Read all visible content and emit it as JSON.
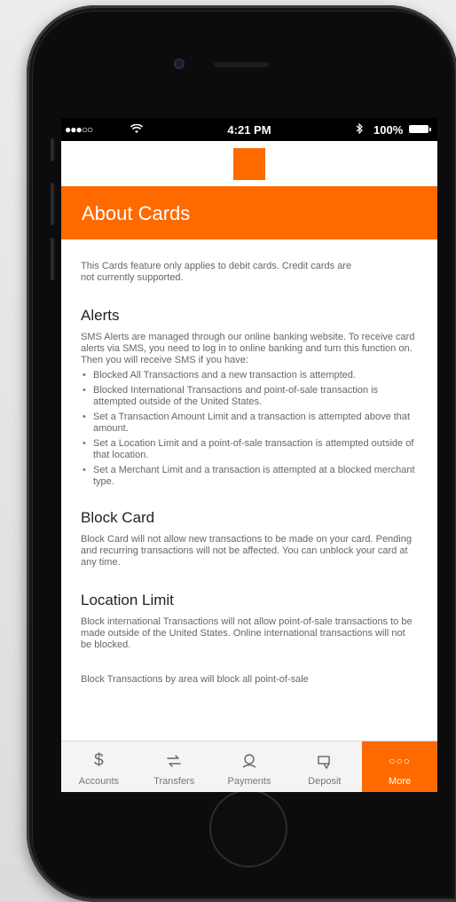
{
  "status_bar": {
    "signal": "●●●○○",
    "time": "4:21 PM",
    "battery": "100%"
  },
  "colors": {
    "brand": "#ff6a00"
  },
  "header": {
    "title": "About Cards"
  },
  "content": {
    "intro": "This Cards feature only applies to debit cards. Credit cards are not currently supported.",
    "alerts": {
      "heading": "Alerts",
      "text": "SMS Alerts are managed through our online banking website. To receive card alerts via SMS, you need to log in to online banking and turn this function on. Then you will receive SMS if you have:",
      "bullets": [
        "Blocked All Transactions and a new transaction is attempted.",
        "Blocked International Transactions and point-of-sale transaction is attempted outside of the United States.",
        "Set a Transaction Amount Limit and a transaction is attempted above that amount.",
        "Set a Location Limit and a point-of-sale transaction is attempted outside of that location.",
        "Set a Merchant Limit and a transaction is attempted at a blocked merchant type."
      ]
    },
    "block_card": {
      "heading": "Block Card",
      "text": "Block Card will not allow new transactions to be made on your card. Pending and recurring transactions will not be affected. You can unblock your card at any time."
    },
    "location_limit": {
      "heading": "Location Limit",
      "text": "Block international Transactions will not allow point-of-sale transactions to be made outside of the United States. Online international transactions will not be blocked.",
      "more": "Block Transactions by area will block all point-of-sale"
    }
  },
  "tabs": [
    {
      "label": "Accounts",
      "icon": "dollar-icon"
    },
    {
      "label": "Transfers",
      "icon": "transfer-icon"
    },
    {
      "label": "Payments",
      "icon": "payments-icon"
    },
    {
      "label": "Deposit",
      "icon": "deposit-icon"
    },
    {
      "label": "More",
      "icon": "more-icon",
      "active": true
    }
  ]
}
